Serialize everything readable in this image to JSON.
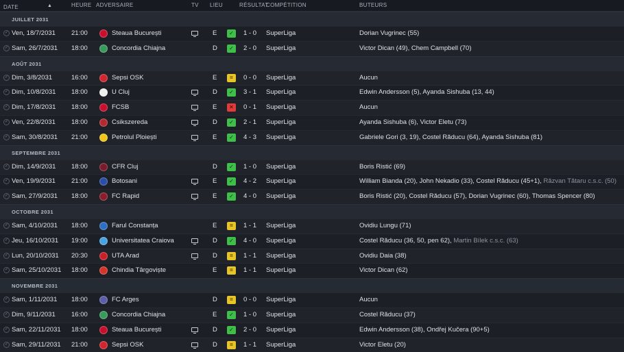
{
  "header": {
    "date": "DATE",
    "time": "HEURE",
    "opponent": "ADVERSAIRE",
    "tv": "TV",
    "venue": "LIEU",
    "result": "RÉSULTAT",
    "competition": "COMPÉTITION",
    "scorers": "BUTEURS"
  },
  "colors": {
    "win": "#3fbf4a",
    "draw": "#e7c527",
    "loss": "#e23b3b",
    "background": "#1d2027"
  },
  "groups": [
    {
      "month": "JUILLET 2031",
      "matches": [
        {
          "date": "Ven, 18/7/2031",
          "time": "21:00",
          "opponent": "Steaua București",
          "badge": "#c8102e",
          "tv": true,
          "venue": "E",
          "result": "win",
          "score": "1 - 0",
          "competition": "SuperLiga",
          "scorers": "Dorian Vugrinec (55)",
          "extra": ""
        },
        {
          "date": "Sam, 26/7/2031",
          "time": "18:00",
          "opponent": "Concordia Chiajna",
          "badge": "#3a9a5c",
          "tv": false,
          "venue": "D",
          "result": "win",
          "score": "2 - 0",
          "competition": "SuperLiga",
          "scorers": "Victor Dican (49), Chem Campbell (70)",
          "extra": ""
        }
      ]
    },
    {
      "month": "AOÛT 2031",
      "matches": [
        {
          "date": "Dim, 3/8/2031",
          "time": "16:00",
          "opponent": "Sepsi OSK",
          "badge": "#d0262f",
          "tv": false,
          "venue": "E",
          "result": "draw",
          "score": "0 - 0",
          "competition": "SuperLiga",
          "scorers": "Aucun",
          "extra": ""
        },
        {
          "date": "Dim, 10/8/2031",
          "time": "18:00",
          "opponent": "U Cluj",
          "badge": "#eeeeee",
          "tv": true,
          "venue": "D",
          "result": "win",
          "score": "3 - 1",
          "competition": "SuperLiga",
          "scorers": "Edwin Andersson (5), Ayanda Sishuba (13, 44)",
          "extra": ""
        },
        {
          "date": "Dim, 17/8/2031",
          "time": "18:00",
          "opponent": "FCSB",
          "badge": "#c8102e",
          "tv": true,
          "venue": "E",
          "result": "loss",
          "score": "0 - 1",
          "competition": "SuperLiga",
          "scorers": "Aucun",
          "extra": ""
        },
        {
          "date": "Ven, 22/8/2031",
          "time": "18:00",
          "opponent": "Csikszereda",
          "badge": "#b02a30",
          "tv": true,
          "venue": "D",
          "result": "win",
          "score": "2 - 1",
          "competition": "SuperLiga",
          "scorers": "Ayanda Sishuba (6), Victor Eletu (73)",
          "extra": ""
        },
        {
          "date": "Sam, 30/8/2031",
          "time": "21:00",
          "opponent": "Petrolul Ploiești",
          "badge": "#f0c419",
          "tv": true,
          "venue": "E",
          "result": "win",
          "score": "4 - 3",
          "competition": "SuperLiga",
          "scorers": "Gabriele Gori (3, 19), Costel Răducu (64), Ayanda Sishuba (81)",
          "extra": ""
        }
      ]
    },
    {
      "month": "SEPTEMBRE 2031",
      "matches": [
        {
          "date": "Dim, 14/9/2031",
          "time": "18:00",
          "opponent": "CFR Cluj",
          "badge": "#7a1a2a",
          "tv": false,
          "venue": "D",
          "result": "win",
          "score": "1 - 0",
          "competition": "SuperLiga",
          "scorers": "Boris Ristić (69)",
          "extra": ""
        },
        {
          "date": "Ven, 19/9/2031",
          "time": "21:00",
          "opponent": "Botosani",
          "badge": "#2a4fa8",
          "tv": true,
          "venue": "E",
          "result": "win",
          "score": "4 - 2",
          "competition": "SuperLiga",
          "scorers": "William Bianda (20), John Nekadio (33), Costel Răducu (45+1),",
          "extra": "Răzvan Tătaru c.s.c. (50)"
        },
        {
          "date": "Sam, 27/9/2031",
          "time": "18:00",
          "opponent": "FC Rapid",
          "badge": "#8a1c2b",
          "tv": true,
          "venue": "E",
          "result": "win",
          "score": "4 - 0",
          "competition": "SuperLiga",
          "scorers": "Boris Ristić (20), Costel Răducu (57), Dorian Vugrinec (60), Thomas Spencer (80)",
          "extra": ""
        }
      ]
    },
    {
      "month": "OCTOBRE 2031",
      "matches": [
        {
          "date": "Sam, 4/10/2031",
          "time": "18:00",
          "opponent": "Farul Constanța",
          "badge": "#2e6fc4",
          "tv": false,
          "venue": "E",
          "result": "draw",
          "score": "1 - 1",
          "competition": "SuperLiga",
          "scorers": "Ovidiu Lungu (71)",
          "extra": ""
        },
        {
          "date": "Jeu, 16/10/2031",
          "time": "19:00",
          "opponent": "Universitatea Craiova",
          "badge": "#4aa3e0",
          "tv": true,
          "venue": "D",
          "result": "win",
          "score": "4 - 0",
          "competition": "SuperLiga",
          "scorers": "Costel Răducu (36, 50, pen 62),",
          "extra": "Martin Bílek c.s.c. (63)"
        },
        {
          "date": "Lun, 20/10/2031",
          "time": "20:30",
          "opponent": "UTA Arad",
          "badge": "#c8202a",
          "tv": true,
          "venue": "D",
          "result": "draw",
          "score": "1 - 1",
          "competition": "SuperLiga",
          "scorers": "Ovidiu Daia (38)",
          "extra": ""
        },
        {
          "date": "Sam, 25/10/2031",
          "time": "18:00",
          "opponent": "Chindia Târgoviște",
          "badge": "#d4352a",
          "tv": false,
          "venue": "E",
          "result": "draw",
          "score": "1 - 1",
          "competition": "SuperLiga",
          "scorers": "Victor Dican (62)",
          "extra": ""
        }
      ]
    },
    {
      "month": "NOVEMBRE 2031",
      "matches": [
        {
          "date": "Sam, 1/11/2031",
          "time": "18:00",
          "opponent": "FC Arges",
          "badge": "#5c5fa8",
          "tv": false,
          "venue": "D",
          "result": "draw",
          "score": "0 - 0",
          "competition": "SuperLiga",
          "scorers": "Aucun",
          "extra": ""
        },
        {
          "date": "Dim, 9/11/2031",
          "time": "16:00",
          "opponent": "Concordia Chiajna",
          "badge": "#3a9a5c",
          "tv": false,
          "venue": "E",
          "result": "win",
          "score": "1 - 0",
          "competition": "SuperLiga",
          "scorers": "Costel Răducu (37)",
          "extra": ""
        },
        {
          "date": "Sam, 22/11/2031",
          "time": "18:00",
          "opponent": "Steaua București",
          "badge": "#c8102e",
          "tv": true,
          "venue": "D",
          "result": "win",
          "score": "2 - 0",
          "competition": "SuperLiga",
          "scorers": "Edwin Andersson (38), Ondřej Kučera (90+5)",
          "extra": ""
        },
        {
          "date": "Sam, 29/11/2031",
          "time": "21:00",
          "opponent": "Sepsi OSK",
          "badge": "#d0262f",
          "tv": true,
          "venue": "D",
          "result": "draw",
          "score": "1 - 1",
          "competition": "SuperLiga",
          "scorers": "Victor Eletu (20)",
          "extra": ""
        }
      ]
    }
  ]
}
